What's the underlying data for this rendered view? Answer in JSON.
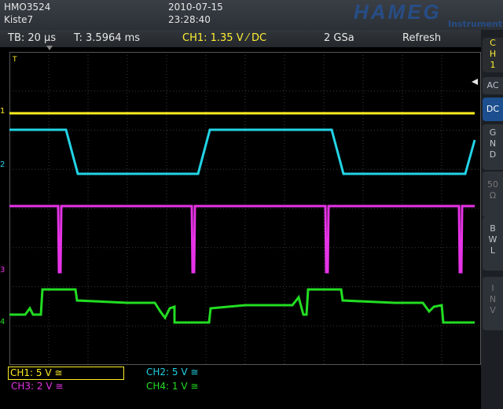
{
  "header": {
    "device_model": "HMO3524",
    "device_name": "Kiste7",
    "date": "2010-07-15",
    "time": "23:28:40",
    "brand": "HAMEG",
    "brand_sub": "Instruments"
  },
  "info": {
    "timebase": "TB: 20 µs",
    "trigger_time": "T: 3.5964 ms",
    "trigger_channel": "CH1: 1.35 V ⁄ DC",
    "sample_rate": "2 GSa",
    "mode": "Refresh"
  },
  "sidebar": {
    "channel_label": [
      "C",
      "H",
      "1"
    ],
    "ac": "AC",
    "dc": "DC",
    "gnd": [
      "G",
      "N",
      "D"
    ],
    "fifty": [
      "50",
      "Ω"
    ],
    "bwl": [
      "B",
      "W",
      "L"
    ],
    "inv": [
      "I",
      "N",
      "V"
    ]
  },
  "channels": {
    "ch1": "CH1: 5 V ≅",
    "ch2": "CH2: 5 V ≅",
    "ch3": "CH3: 2 V ≅",
    "ch4": "CH4: 1 V ≅"
  },
  "markers": {
    "ch1": "1",
    "ch2": "2",
    "ch3": "3",
    "ch4": "4",
    "trigger": "T"
  },
  "colors": {
    "ch1": "#ffee22",
    "ch2": "#22d4e6",
    "ch3": "#e633e6",
    "ch4": "#22dd22",
    "grid": "#3a3a3a",
    "accent": "#1d4f8f"
  }
}
